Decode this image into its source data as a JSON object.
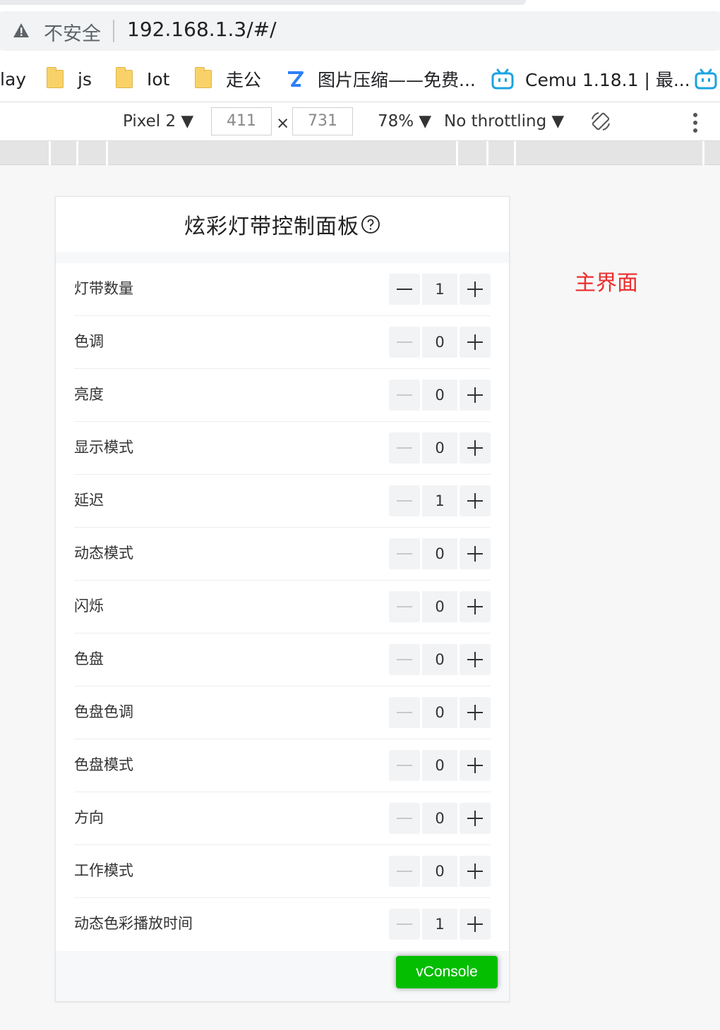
{
  "browser": {
    "insecure_label": "不安全",
    "url": "192.168.1.3/#/"
  },
  "bookmarks": [
    {
      "label": "lay",
      "icon": "none"
    },
    {
      "label": "js",
      "icon": "folder-icon"
    },
    {
      "label": "Iot",
      "icon": "folder-icon"
    },
    {
      "label": "走公",
      "icon": "folder-icon"
    },
    {
      "label": "图片压缩——免费...",
      "icon": "z-logo-icon"
    },
    {
      "label": "Cemu 1.18.1 | 最...",
      "icon": "bilibili-tv-icon"
    }
  ],
  "devtools": {
    "device": "Pixel 2 ▼",
    "width": "411",
    "times": "×",
    "height": "731",
    "zoom": "78% ▼",
    "throttling": "No throttling ▼"
  },
  "app": {
    "title": "炫彩灯带控制面板",
    "rows": [
      {
        "label": "灯带数量",
        "value": "1",
        "minus_disabled": false
      },
      {
        "label": "色调",
        "value": "0",
        "minus_disabled": true
      },
      {
        "label": "亮度",
        "value": "0",
        "minus_disabled": true
      },
      {
        "label": "显示模式",
        "value": "0",
        "minus_disabled": true
      },
      {
        "label": "延迟",
        "value": "1",
        "minus_disabled": true
      },
      {
        "label": "动态模式",
        "value": "0",
        "minus_disabled": true
      },
      {
        "label": "闪烁",
        "value": "0",
        "minus_disabled": true
      },
      {
        "label": "色盘",
        "value": "0",
        "minus_disabled": true
      },
      {
        "label": "色盘色调",
        "value": "0",
        "minus_disabled": true
      },
      {
        "label": "色盘模式",
        "value": "0",
        "minus_disabled": true
      },
      {
        "label": "方向",
        "value": "0",
        "minus_disabled": true
      },
      {
        "label": "工作模式",
        "value": "0",
        "minus_disabled": true
      },
      {
        "label": "动态色彩播放时间",
        "value": "1",
        "minus_disabled": true
      }
    ],
    "vconsole_label": "vConsole"
  },
  "annotation": "主界面",
  "colors": {
    "accent_green": "#04be02",
    "annotation_red": "#ec2d2d",
    "warning_gray": "#5f6368"
  }
}
